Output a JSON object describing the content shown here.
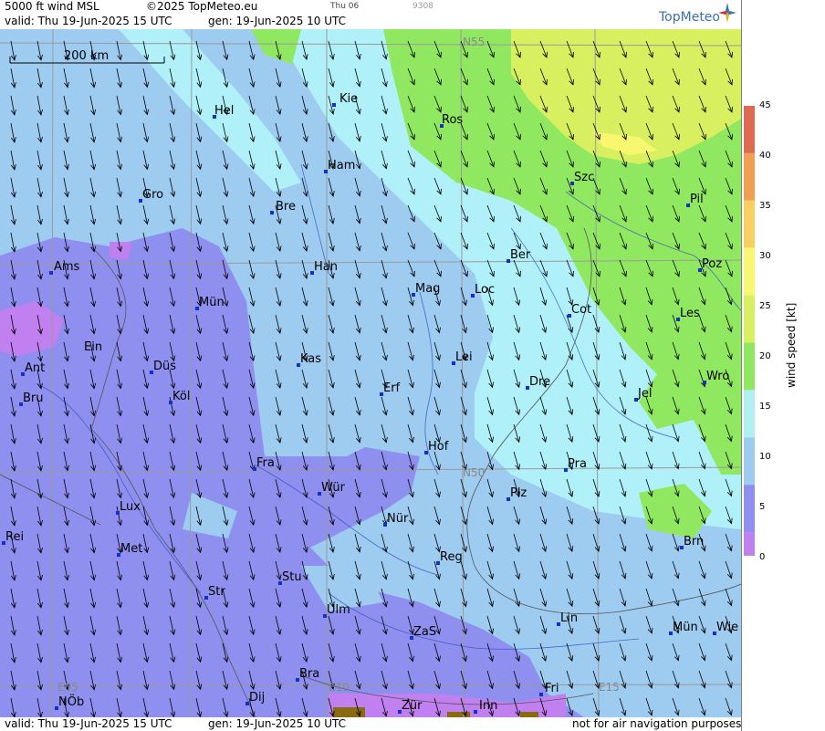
{
  "header": {
    "title": "5000 ft wind MSL",
    "copyright": "©2025 TopMeteo.eu",
    "valid": "valid:  Thu  19-Jun-2025  15 UTC",
    "generated": "gen: 19-Jun-2025 10 UTC",
    "day_code": "Thu 06",
    "run_code": "9308",
    "logo": "TopMeteo"
  },
  "footer": {
    "valid": "valid:  Thu  19-Jun-2025  15 UTC",
    "generated": "gen: 19-Jun-2025 10 UTC",
    "disclaimer": "not for air navigation purposes"
  },
  "scale_bar": {
    "label": "200 km"
  },
  "grid_labels": {
    "n55": "N55",
    "n50": "N50",
    "e05": "E05",
    "e10": "E10",
    "e15": "E15"
  },
  "legend": {
    "axis_label": "wind speed  [kt]",
    "ticks": [
      "45",
      "40",
      "35",
      "30",
      "25",
      "20",
      "15",
      "10",
      "5",
      "0"
    ],
    "colors": [
      "#e06a50",
      "#f0a050",
      "#f8d060",
      "#f8f870",
      "#d8f060",
      "#90e860",
      "#b0f0f0",
      "#9ecbf0",
      "#8f8ff0",
      "#c080f0"
    ]
  },
  "cities": [
    "Kie",
    "Hel",
    "Ros",
    "Ham",
    "Szc",
    "Gro",
    "Bre",
    "Pil",
    "Ber",
    "Ams",
    "Han",
    "Poz",
    "Mag",
    "Loc",
    "Mün",
    "Cot",
    "Les",
    "Ein",
    "Kas",
    "Lei",
    "Ant",
    "Düs",
    "Wro",
    "Dre",
    "Erf",
    "Köl",
    "Bru",
    "Jel",
    "Hof",
    "Fra",
    "Pra",
    "Wür",
    "Plz",
    "Lux",
    "Nür",
    "Rei",
    "Met",
    "Reg",
    "Stu",
    "Str",
    "Brn",
    "Ulm",
    "Lin",
    "Mün",
    "Wie",
    "Bra",
    "Fri",
    "NÖb",
    "Dij",
    "Zür",
    "Inn",
    "ZaS"
  ]
}
